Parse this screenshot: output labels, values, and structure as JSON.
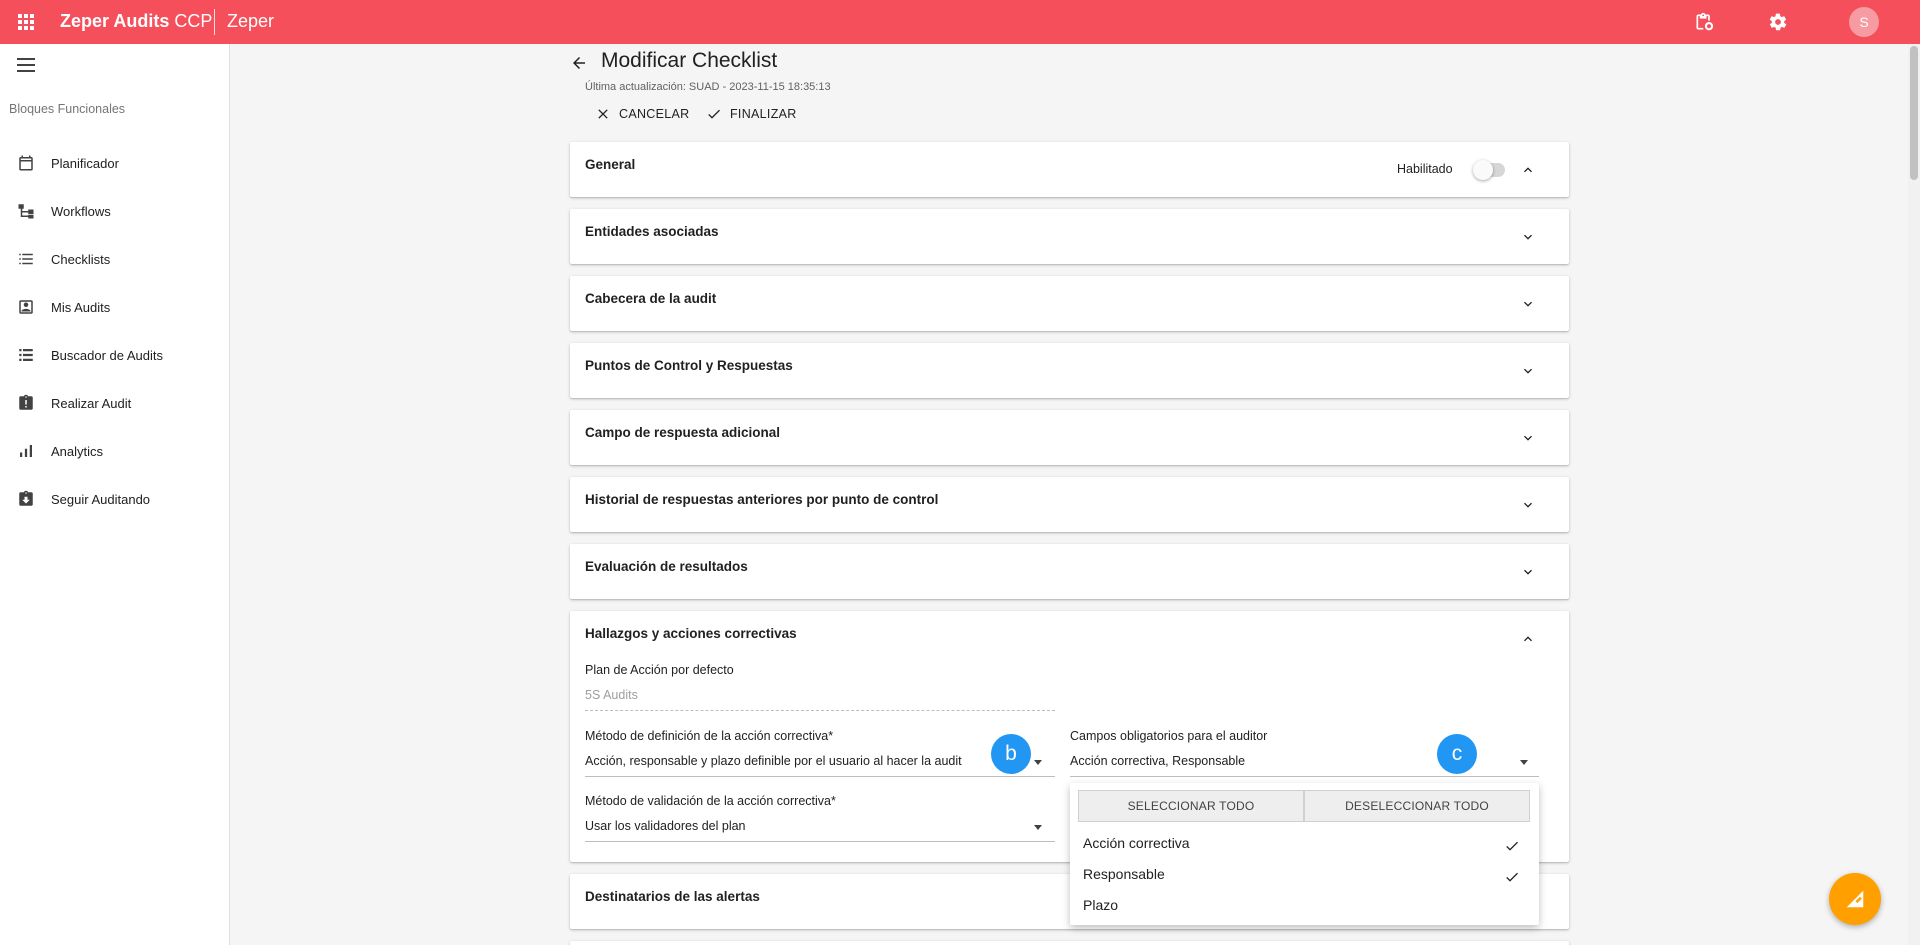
{
  "topbar": {
    "brand_bold": "Zeper Audits",
    "brand_light": " CCP",
    "tenant": "Zeper",
    "avatar_initial": "S",
    "bg_color": "#f44f5b"
  },
  "sidebar": {
    "section_label": "Bloques Funcionales",
    "items": [
      {
        "label": "Planificador",
        "icon": "calendar-icon"
      },
      {
        "label": "Workflows",
        "icon": "workflow-icon"
      },
      {
        "label": "Checklists",
        "icon": "list-icon"
      },
      {
        "label": "Mis Audits",
        "icon": "person-box-icon"
      },
      {
        "label": "Buscador de Audits",
        "icon": "list-search-icon"
      },
      {
        "label": "Realizar Audit",
        "icon": "clipboard-alert-icon"
      },
      {
        "label": "Analytics",
        "icon": "bar-chart-icon"
      },
      {
        "label": "Seguir Auditando",
        "icon": "clipboard-down-icon"
      }
    ]
  },
  "header": {
    "title": "Modificar Checklist",
    "last_update": "Última actualización: SUAD - 2023-11-15 18:35:13",
    "cancel_label": "CANCELAR",
    "finish_label": "FINALIZAR"
  },
  "panels": {
    "general": {
      "title": "General",
      "enabled_label": "Habilitado",
      "enabled": false
    },
    "entities": {
      "title": "Entidades asociadas"
    },
    "header_audit": {
      "title": "Cabecera de la audit"
    },
    "control_points": {
      "title": "Puntos de Control y Respuestas"
    },
    "extra_field": {
      "title": "Campo de respuesta adicional"
    },
    "history": {
      "title": "Historial de respuestas anteriores por punto de control"
    },
    "evaluation": {
      "title": "Evaluación de resultados"
    },
    "findings": {
      "title": "Hallazgos y acciones correctivas",
      "default_plan_label": "Plan de Acción por defecto",
      "default_plan_value": "5S Audits",
      "definition_method_label": "Método de definición de la acción correctiva*",
      "definition_method_value": "Acción, responsable y plazo definible por el usuario al hacer la audit",
      "required_fields_label": "Campos obligatorios para el auditor",
      "required_fields_value": "Acción correctiva, Responsable",
      "validation_method_label": "Método de validación de la acción correctiva*",
      "validation_method_value": "Usar los validadores del plan"
    },
    "alerts": {
      "title": "Destinatarios de las alertas"
    }
  },
  "dropdown": {
    "select_all": "SELECCIONAR TODO",
    "deselect_all": "DESELECCIONAR TODO",
    "options": [
      {
        "label": "Acción correctiva",
        "checked": true
      },
      {
        "label": "Responsable",
        "checked": true
      },
      {
        "label": "Plazo",
        "checked": false
      }
    ]
  },
  "badges": {
    "b": "b",
    "c": "c",
    "color": "#2196f3"
  },
  "fab_color": "#ffa000"
}
